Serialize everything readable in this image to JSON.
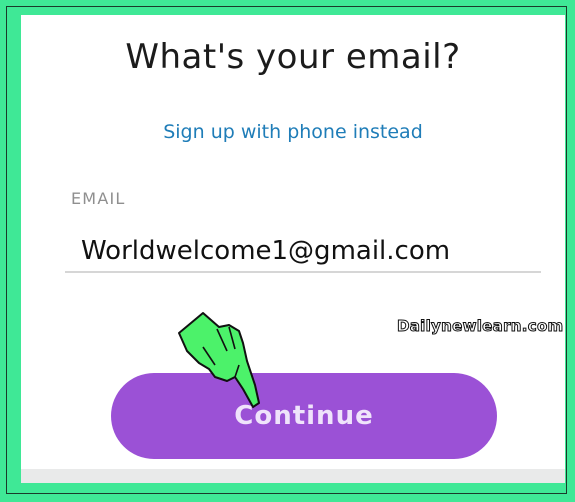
{
  "page": {
    "title": "What's your email?",
    "phone_link": "Sign up with phone instead",
    "email_label": "EMAIL",
    "email_value": "Worldwelcome1@gmail.com",
    "continue_label": "Continue",
    "watermark": "Dailynewlearn.com"
  },
  "colors": {
    "border_green": "#3fe896",
    "link_blue": "#1f7db8",
    "button_purple": "#9b51d6",
    "hand_green": "#4cf26a"
  },
  "icons": {
    "pointer": "pointing-hand-icon"
  }
}
